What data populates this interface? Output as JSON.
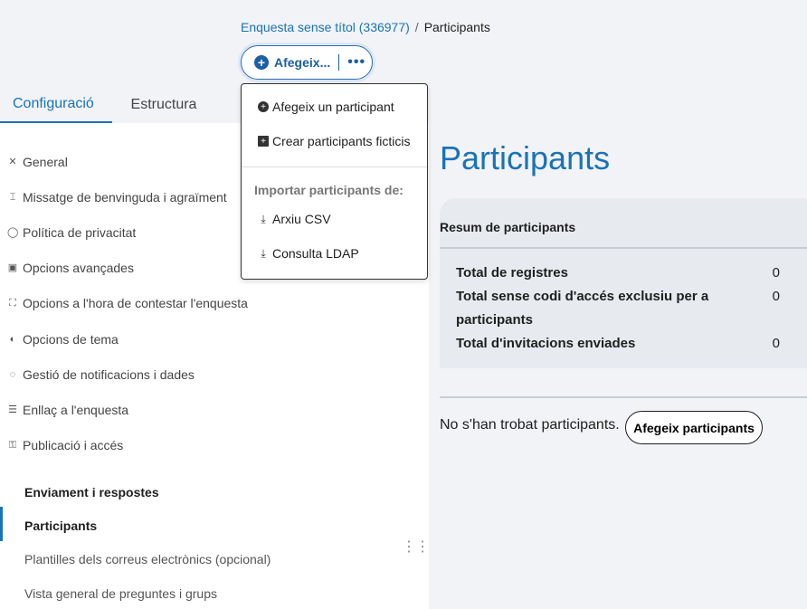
{
  "breadcrumb": {
    "survey": "Enquesta sense títol (336977)",
    "separator": "/",
    "current": "Participants"
  },
  "split_button": {
    "label": "Afegeix...",
    "more": "•••"
  },
  "tabs": [
    {
      "label": "Configuració"
    },
    {
      "label": "Estructura"
    }
  ],
  "sidebar": {
    "items": [
      {
        "label": "General",
        "icon": "tools-icon"
      },
      {
        "label": "Missatge de benvinguda i agraïment",
        "icon": "text-icon"
      },
      {
        "label": "Política de privacitat",
        "icon": "shield-icon"
      },
      {
        "label": "Opcions avançades",
        "icon": "options-icon"
      },
      {
        "label": "Opcions a l'hora de contestar l'enquesta",
        "icon": "focus-icon"
      },
      {
        "label": "Opcions de tema",
        "icon": "contrast-icon"
      },
      {
        "label": "Gestió de notificacions i dades",
        "icon": "bell-icon"
      },
      {
        "label": "Enllaç a l'enquesta",
        "icon": "list-icon"
      },
      {
        "label": "Publicació i accés",
        "icon": "key-icon"
      }
    ],
    "section_title": "Enviament i respostes",
    "sub_items": [
      {
        "label": "Participants"
      },
      {
        "label": "Plantilles dels correus electrònics (opcional)"
      },
      {
        "label": "Vista general de preguntes i grups"
      }
    ]
  },
  "dropdown": {
    "items": [
      {
        "label": "Afegeix un participant"
      },
      {
        "label": "Crear participants ficticis"
      }
    ],
    "import_heading": "Importar participants de:",
    "import_items": [
      {
        "label": "Arxiu CSV"
      },
      {
        "label": "Consulta LDAP"
      }
    ]
  },
  "main": {
    "title": "Participants",
    "summary": {
      "title": "Resum de participants",
      "rows": [
        {
          "label": "Total de registres",
          "value": "0"
        },
        {
          "label": "Total sense codi d'accés exclusiu per a participants",
          "value": "0"
        },
        {
          "label": "Total d'invitacions enviades",
          "value": "0"
        }
      ]
    },
    "empty_message": "No s'han trobat participants.",
    "add_button": "Afegeix participants"
  },
  "colors": {
    "accent": "#1a73b8",
    "button_blue": "#1a5fa8",
    "panel_bg": "#f1f3f6"
  }
}
